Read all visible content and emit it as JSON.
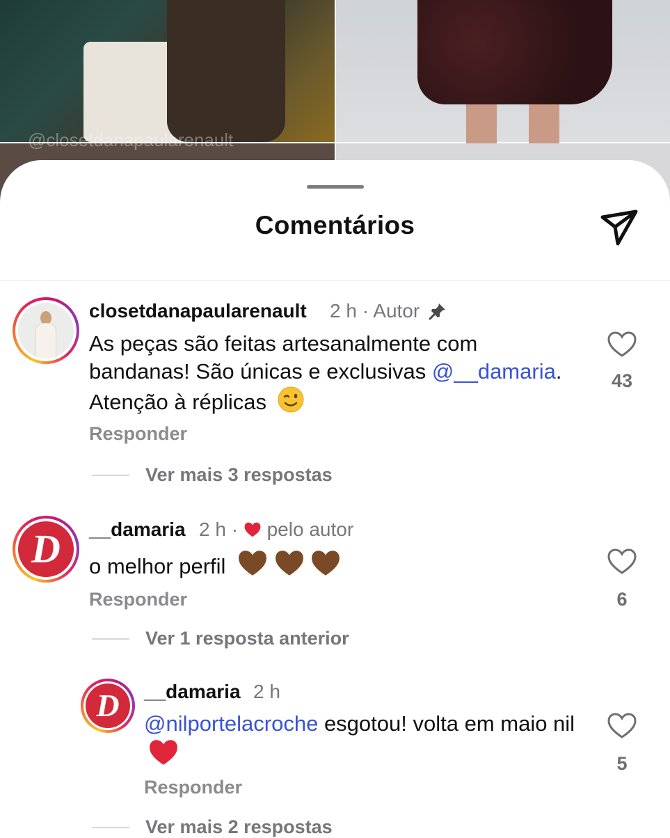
{
  "background": {
    "watermark": "@closetdanapaularenault"
  },
  "sheet": {
    "title": "Comentários"
  },
  "comments": [
    {
      "username": "closetdanapaularenault",
      "time": "2 h",
      "separator": "·",
      "badge": "Autor",
      "pinned": true,
      "text_parts": [
        "As peças são feitas artesanalmente com bandanas! São únicas e exclusivas ",
        "@__damaria",
        ". Atenção à réplicas"
      ],
      "emoji": "winking-face",
      "reply_label": "Responder",
      "likes": "43",
      "thread_link": "Ver mais 3 respostas"
    },
    {
      "username": "__damaria",
      "time": "2 h",
      "separator": "·",
      "liked_by_author": "pelo autor",
      "text": "o melhor perfil",
      "emoji": "brown-heart x3",
      "reply_label": "Responder",
      "likes": "6",
      "thread_link": "Ver 1 resposta anterior"
    }
  ],
  "replies": [
    {
      "username": "__damaria",
      "time": "2 h",
      "text_parts": [
        "@nilportelacroche",
        " esgotou! volta em maio nil"
      ],
      "emoji": "red-heart",
      "reply_label": "Responder",
      "likes": "5",
      "thread_link": "Ver mais 2 respostas"
    }
  ],
  "colors": {
    "mention": "#3852d6",
    "heart_red": "#e0243a",
    "brown_heart": "#7a4a26",
    "avatar_brand": "#d22a3a"
  }
}
